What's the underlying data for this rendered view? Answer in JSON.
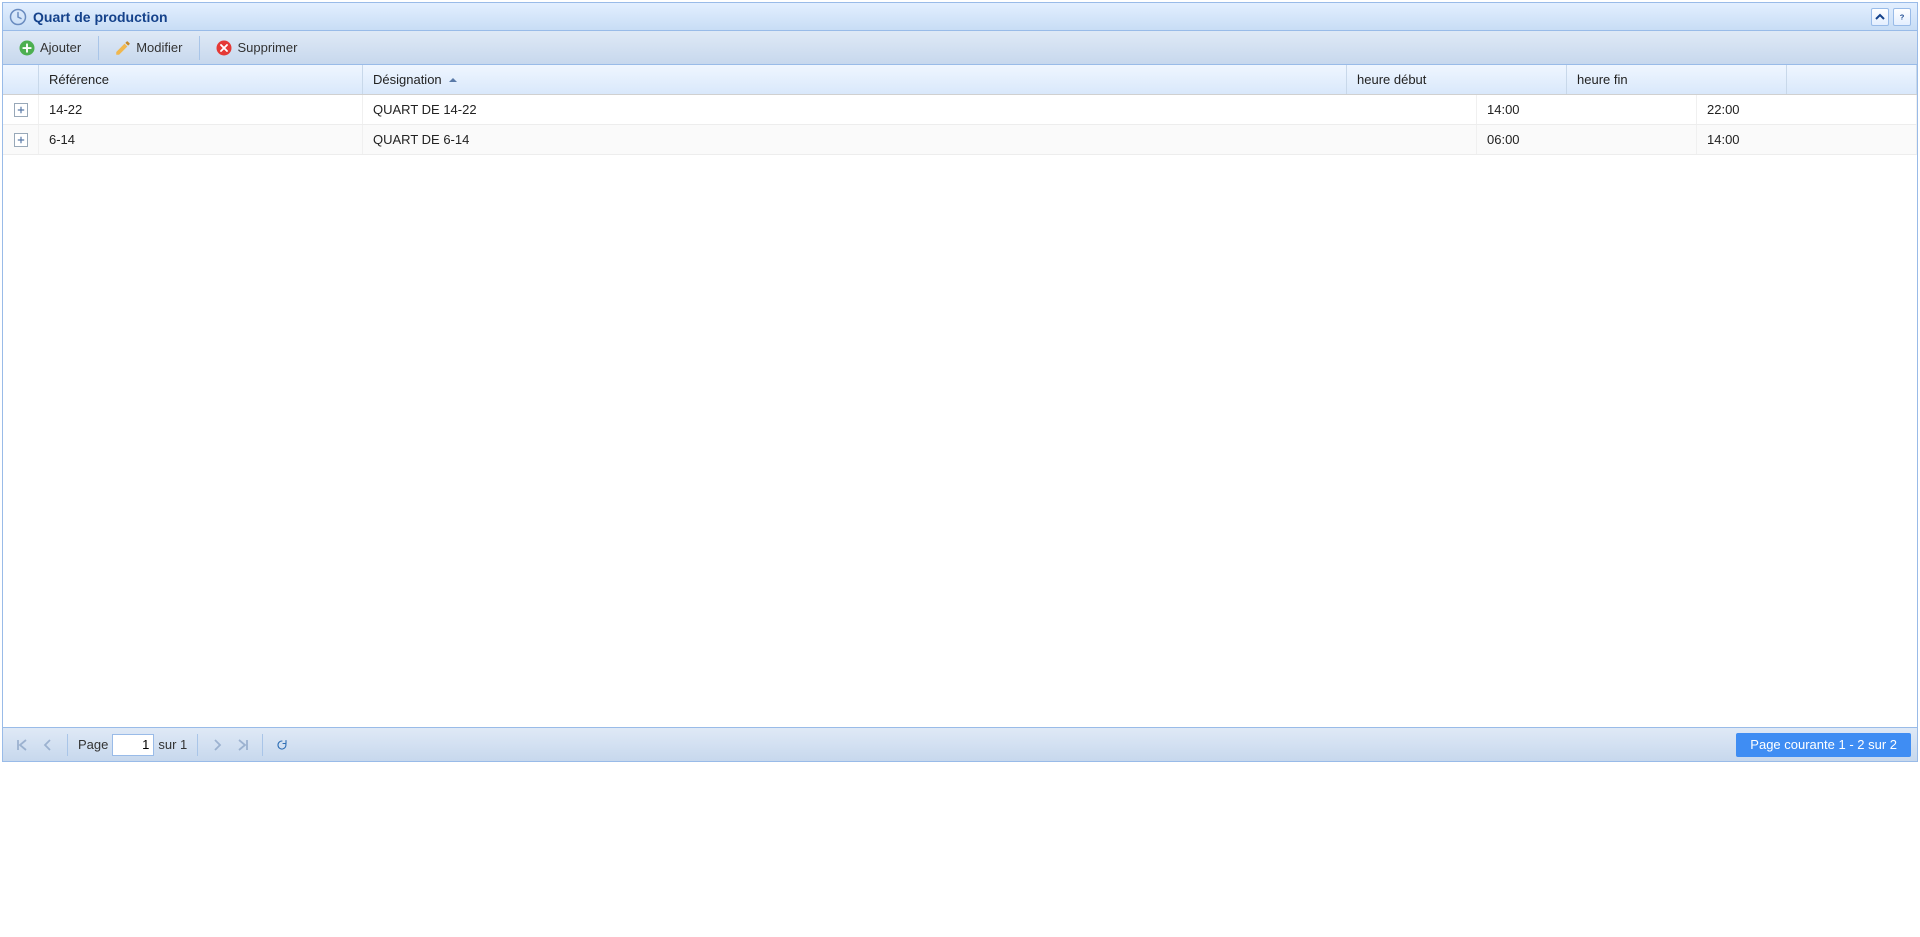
{
  "panel": {
    "title": "Quart de production"
  },
  "toolbar": {
    "add_label": "Ajouter",
    "edit_label": "Modifier",
    "delete_label": "Supprimer"
  },
  "grid": {
    "columns": {
      "reference": "Référence",
      "designation": "Désignation",
      "start": "heure début",
      "end": "heure fin"
    },
    "rows": [
      {
        "reference": "14-22",
        "designation": "QUART DE 14-22",
        "start": "14:00",
        "end": "22:00"
      },
      {
        "reference": "6-14",
        "designation": "QUART DE 6-14",
        "start": "06:00",
        "end": "14:00"
      }
    ]
  },
  "paging": {
    "page_label": "Page",
    "page_value": "1",
    "of_label": "sur 1",
    "status": "Page courante 1 - 2 sur 2"
  }
}
